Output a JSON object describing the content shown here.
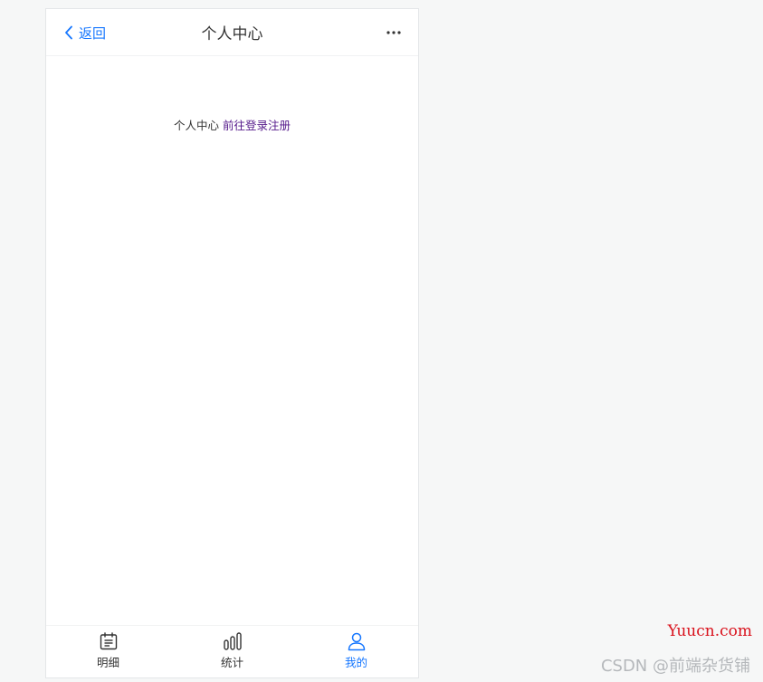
{
  "nav": {
    "back_label": "返回",
    "title": "个人中心",
    "accent_color": "#1677ff"
  },
  "content": {
    "text": "个人中心",
    "link_text": "前往登录注册"
  },
  "tabs": [
    {
      "label": "明细",
      "icon": "detail-list-icon",
      "active": false
    },
    {
      "label": "统计",
      "icon": "bar-chart-icon",
      "active": false
    },
    {
      "label": "我的",
      "icon": "user-icon",
      "active": true
    }
  ],
  "watermarks": {
    "yuucn": "Yuucn.com",
    "csdn": "CSDN @前端杂货铺"
  }
}
